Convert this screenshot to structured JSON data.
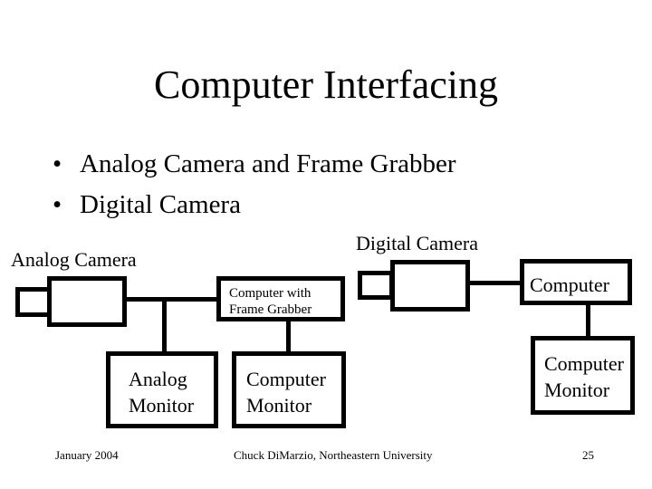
{
  "slide": {
    "title": "Computer Interfacing",
    "bullets": [
      "Analog Camera and Frame Grabber",
      "Digital Camera"
    ],
    "bullet_glyph": "•"
  },
  "diagram": {
    "analog_setup": {
      "camera_label": "Analog Camera",
      "computer_line1": "Computer with",
      "computer_line2": "Frame Grabber",
      "analog_monitor_line1": "Analog",
      "analog_monitor_line2": "Monitor",
      "computer_monitor_line1": "Computer",
      "computer_monitor_line2": "Monitor"
    },
    "digital_setup": {
      "camera_label": "Digital Camera",
      "computer_label": "Computer",
      "computer_monitor_line1": "Computer",
      "computer_monitor_line2": "Monitor"
    }
  },
  "footer": {
    "date": "January 2004",
    "author": "Chuck DiMarzio, Northeastern University",
    "page_number": "25"
  }
}
